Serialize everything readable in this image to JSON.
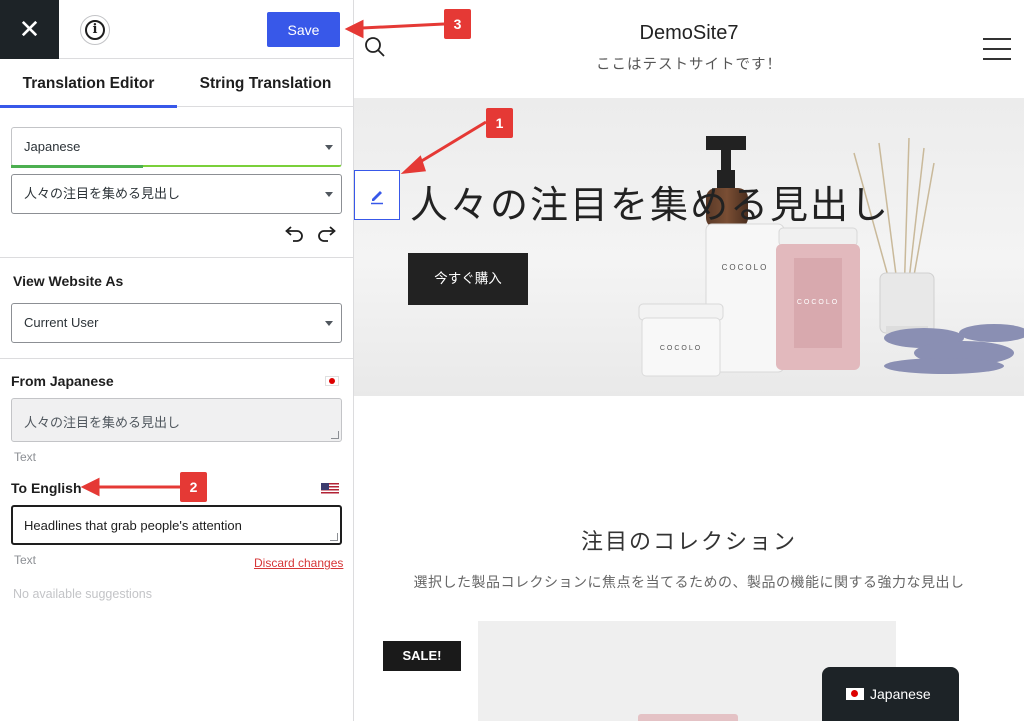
{
  "editor": {
    "close_glyph": "✕",
    "save_label": "Save",
    "tabs": [
      {
        "label": "Translation Editor",
        "active": true
      },
      {
        "label": "String Translation",
        "active": false
      }
    ],
    "language_select": "Japanese",
    "string_select": "人々の注目を集める見出し",
    "view_as": {
      "label": "View Website As",
      "value": "Current User"
    },
    "from": {
      "label": "From Japanese",
      "value": "人々の注目を集める見出し",
      "type": "Text"
    },
    "to": {
      "label": "To English",
      "value": "Headlines that grab people's attention",
      "type": "Text",
      "discard_label": "Discard changes"
    },
    "suggestions": "No available suggestions"
  },
  "site": {
    "title": "DemoSite7",
    "tagline": "ここはテストサイトです！",
    "hero": {
      "heading": "人々の注目を集める見出し",
      "button": "今すぐ購入",
      "product_brand": "COCOLO"
    },
    "collection": {
      "title": "注目のコレクション",
      "subtitle": "選択した製品コレクションに焦点を当てるための、製品の機能に関する強力な見出し"
    },
    "sale_badge": "SALE!",
    "language_switcher": "Japanese"
  },
  "annotations": [
    "1",
    "2",
    "3"
  ],
  "colors": {
    "accent": "#3858e9",
    "dark": "#1d2327",
    "annotation": "#e53935",
    "danger": "#d63638"
  }
}
